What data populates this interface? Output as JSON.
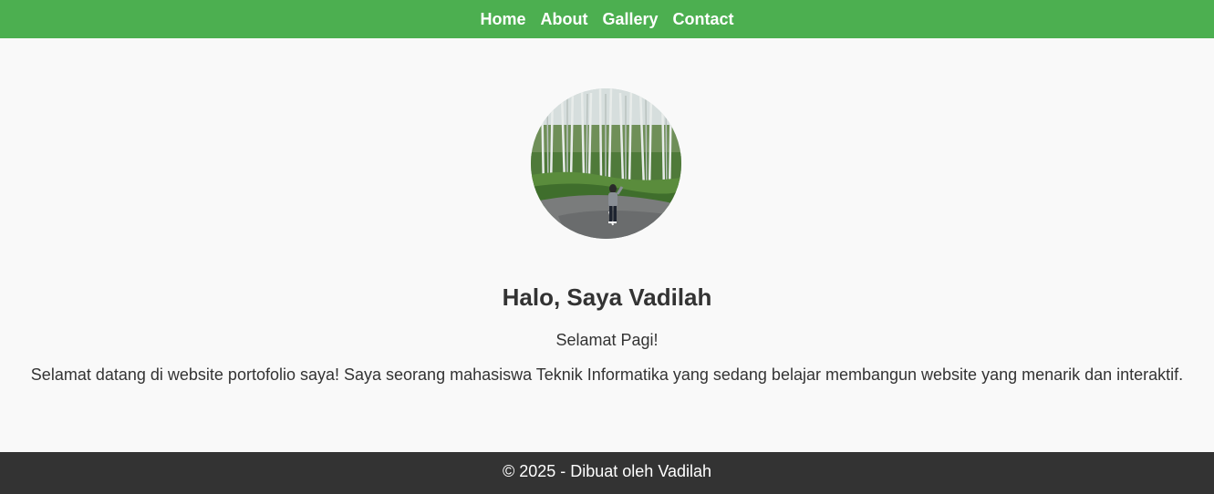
{
  "nav": {
    "items": [
      {
        "label": "Home"
      },
      {
        "label": "About"
      },
      {
        "label": "Gallery"
      },
      {
        "label": "Contact"
      }
    ]
  },
  "hero": {
    "title": "Halo, Saya Vadilah",
    "greeting": "Selamat Pagi!",
    "intro": "Selamat datang di website portofolio saya! Saya seorang mahasiswa Teknik Informatika yang sedang belajar membangun website yang menarik dan interaktif."
  },
  "footer": {
    "text": "© 2025 - Dibuat oleh Vadilah"
  },
  "colors": {
    "nav_background": "#4caf50",
    "page_background": "#f9f9f9",
    "footer_background": "#333333",
    "text": "#333333"
  }
}
